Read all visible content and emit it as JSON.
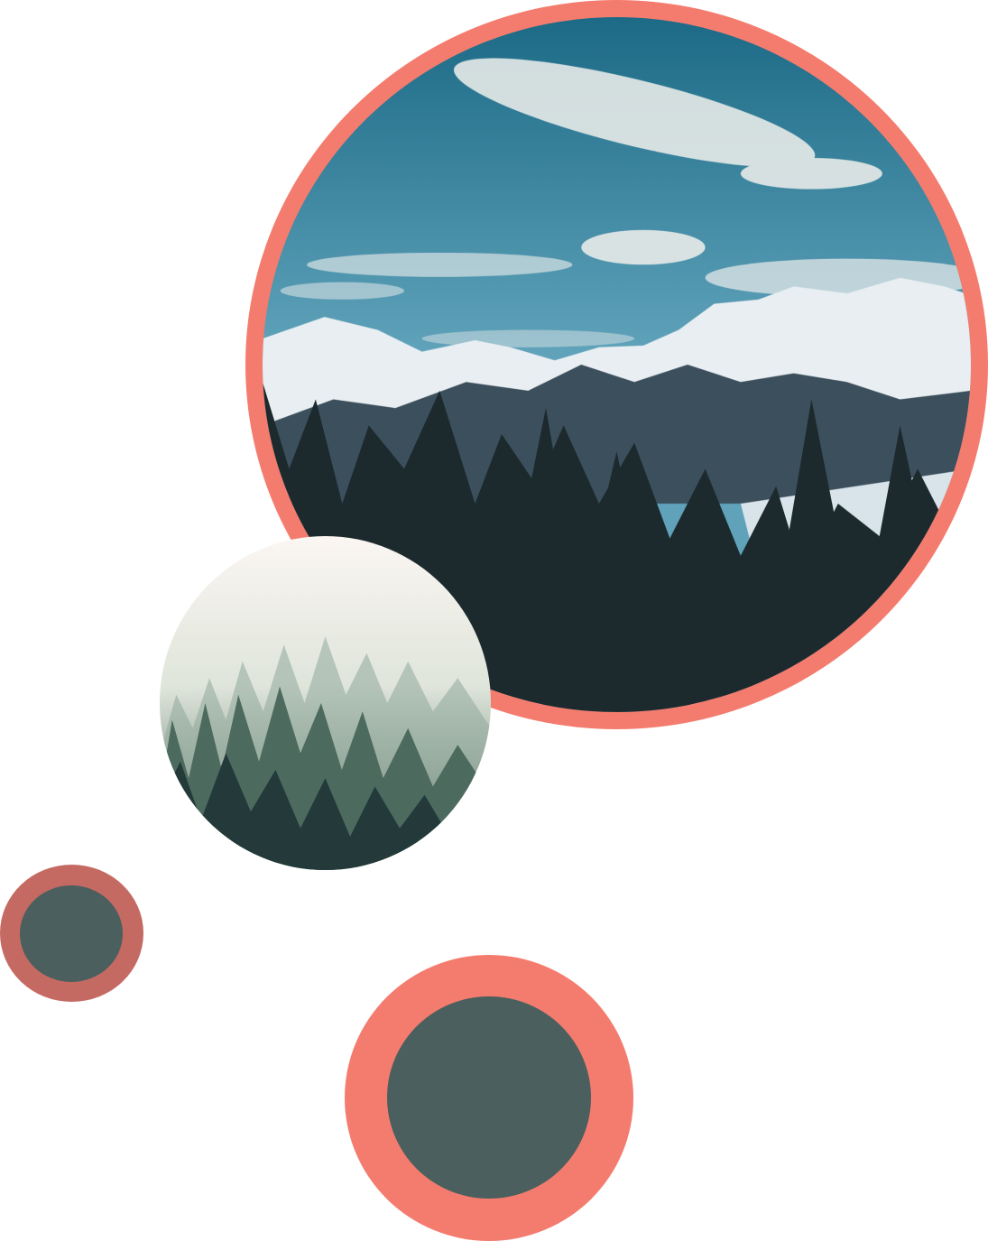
{
  "colors": {
    "ring_coral": "#f47c6e",
    "ring_dusty": "#c46a62",
    "core_slate": "#4a5f5e"
  },
  "images": {
    "mountain": {
      "description_icon": "mountain-landscape-image",
      "sky_top": "#1c6a86",
      "sky_bottom": "#5fa2ba",
      "snow": "#e8eef2",
      "shadow_snow": "#a9c0cf",
      "rock": "#3c4f5c",
      "trees": "#1c2a2e"
    },
    "forest": {
      "description_icon": "misty-forest-image",
      "mist_top": "#fbf6f3",
      "mist_mid": "#dfe5da",
      "trees_far": "#8fa79a",
      "trees_mid": "#4d6a5e",
      "trees_near": "#23393a"
    }
  }
}
